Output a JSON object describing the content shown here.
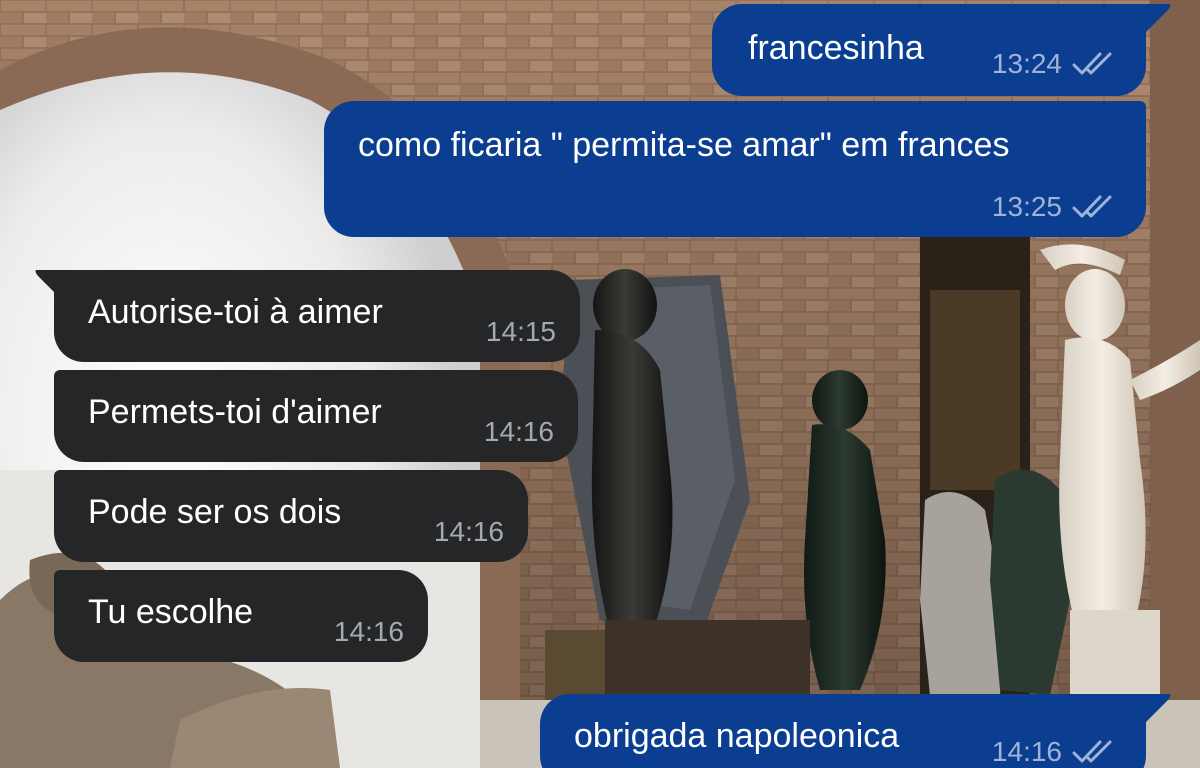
{
  "chat": {
    "messages": [
      {
        "direction": "outgoing",
        "text": "francesinha",
        "time": "13:24",
        "status_icon": "double-check-icon"
      },
      {
        "direction": "outgoing",
        "text": "como ficaria \" permita-se amar\" em frances",
        "time": "13:25",
        "status_icon": "double-check-icon"
      },
      {
        "direction": "incoming",
        "text": "Autorise-toi à aimer",
        "time": "14:15"
      },
      {
        "direction": "incoming",
        "text": "Permets-toi d'aimer",
        "time": "14:16"
      },
      {
        "direction": "incoming",
        "text": "Pode ser os dois",
        "time": "14:16"
      },
      {
        "direction": "incoming",
        "text": "Tu escolhe",
        "time": "14:16"
      },
      {
        "direction": "outgoing",
        "text": "obrigada napoleonica",
        "time": "14:16",
        "status_icon": "double-check-icon"
      }
    ]
  },
  "colors": {
    "outgoing_bubble": "#0b3d91",
    "incoming_bubble": "#252627",
    "outgoing_meta": "#9fb3d6",
    "incoming_meta": "#a5a8ad"
  },
  "wallpaper": {
    "description_icon": "museum-sculptures-photo"
  }
}
